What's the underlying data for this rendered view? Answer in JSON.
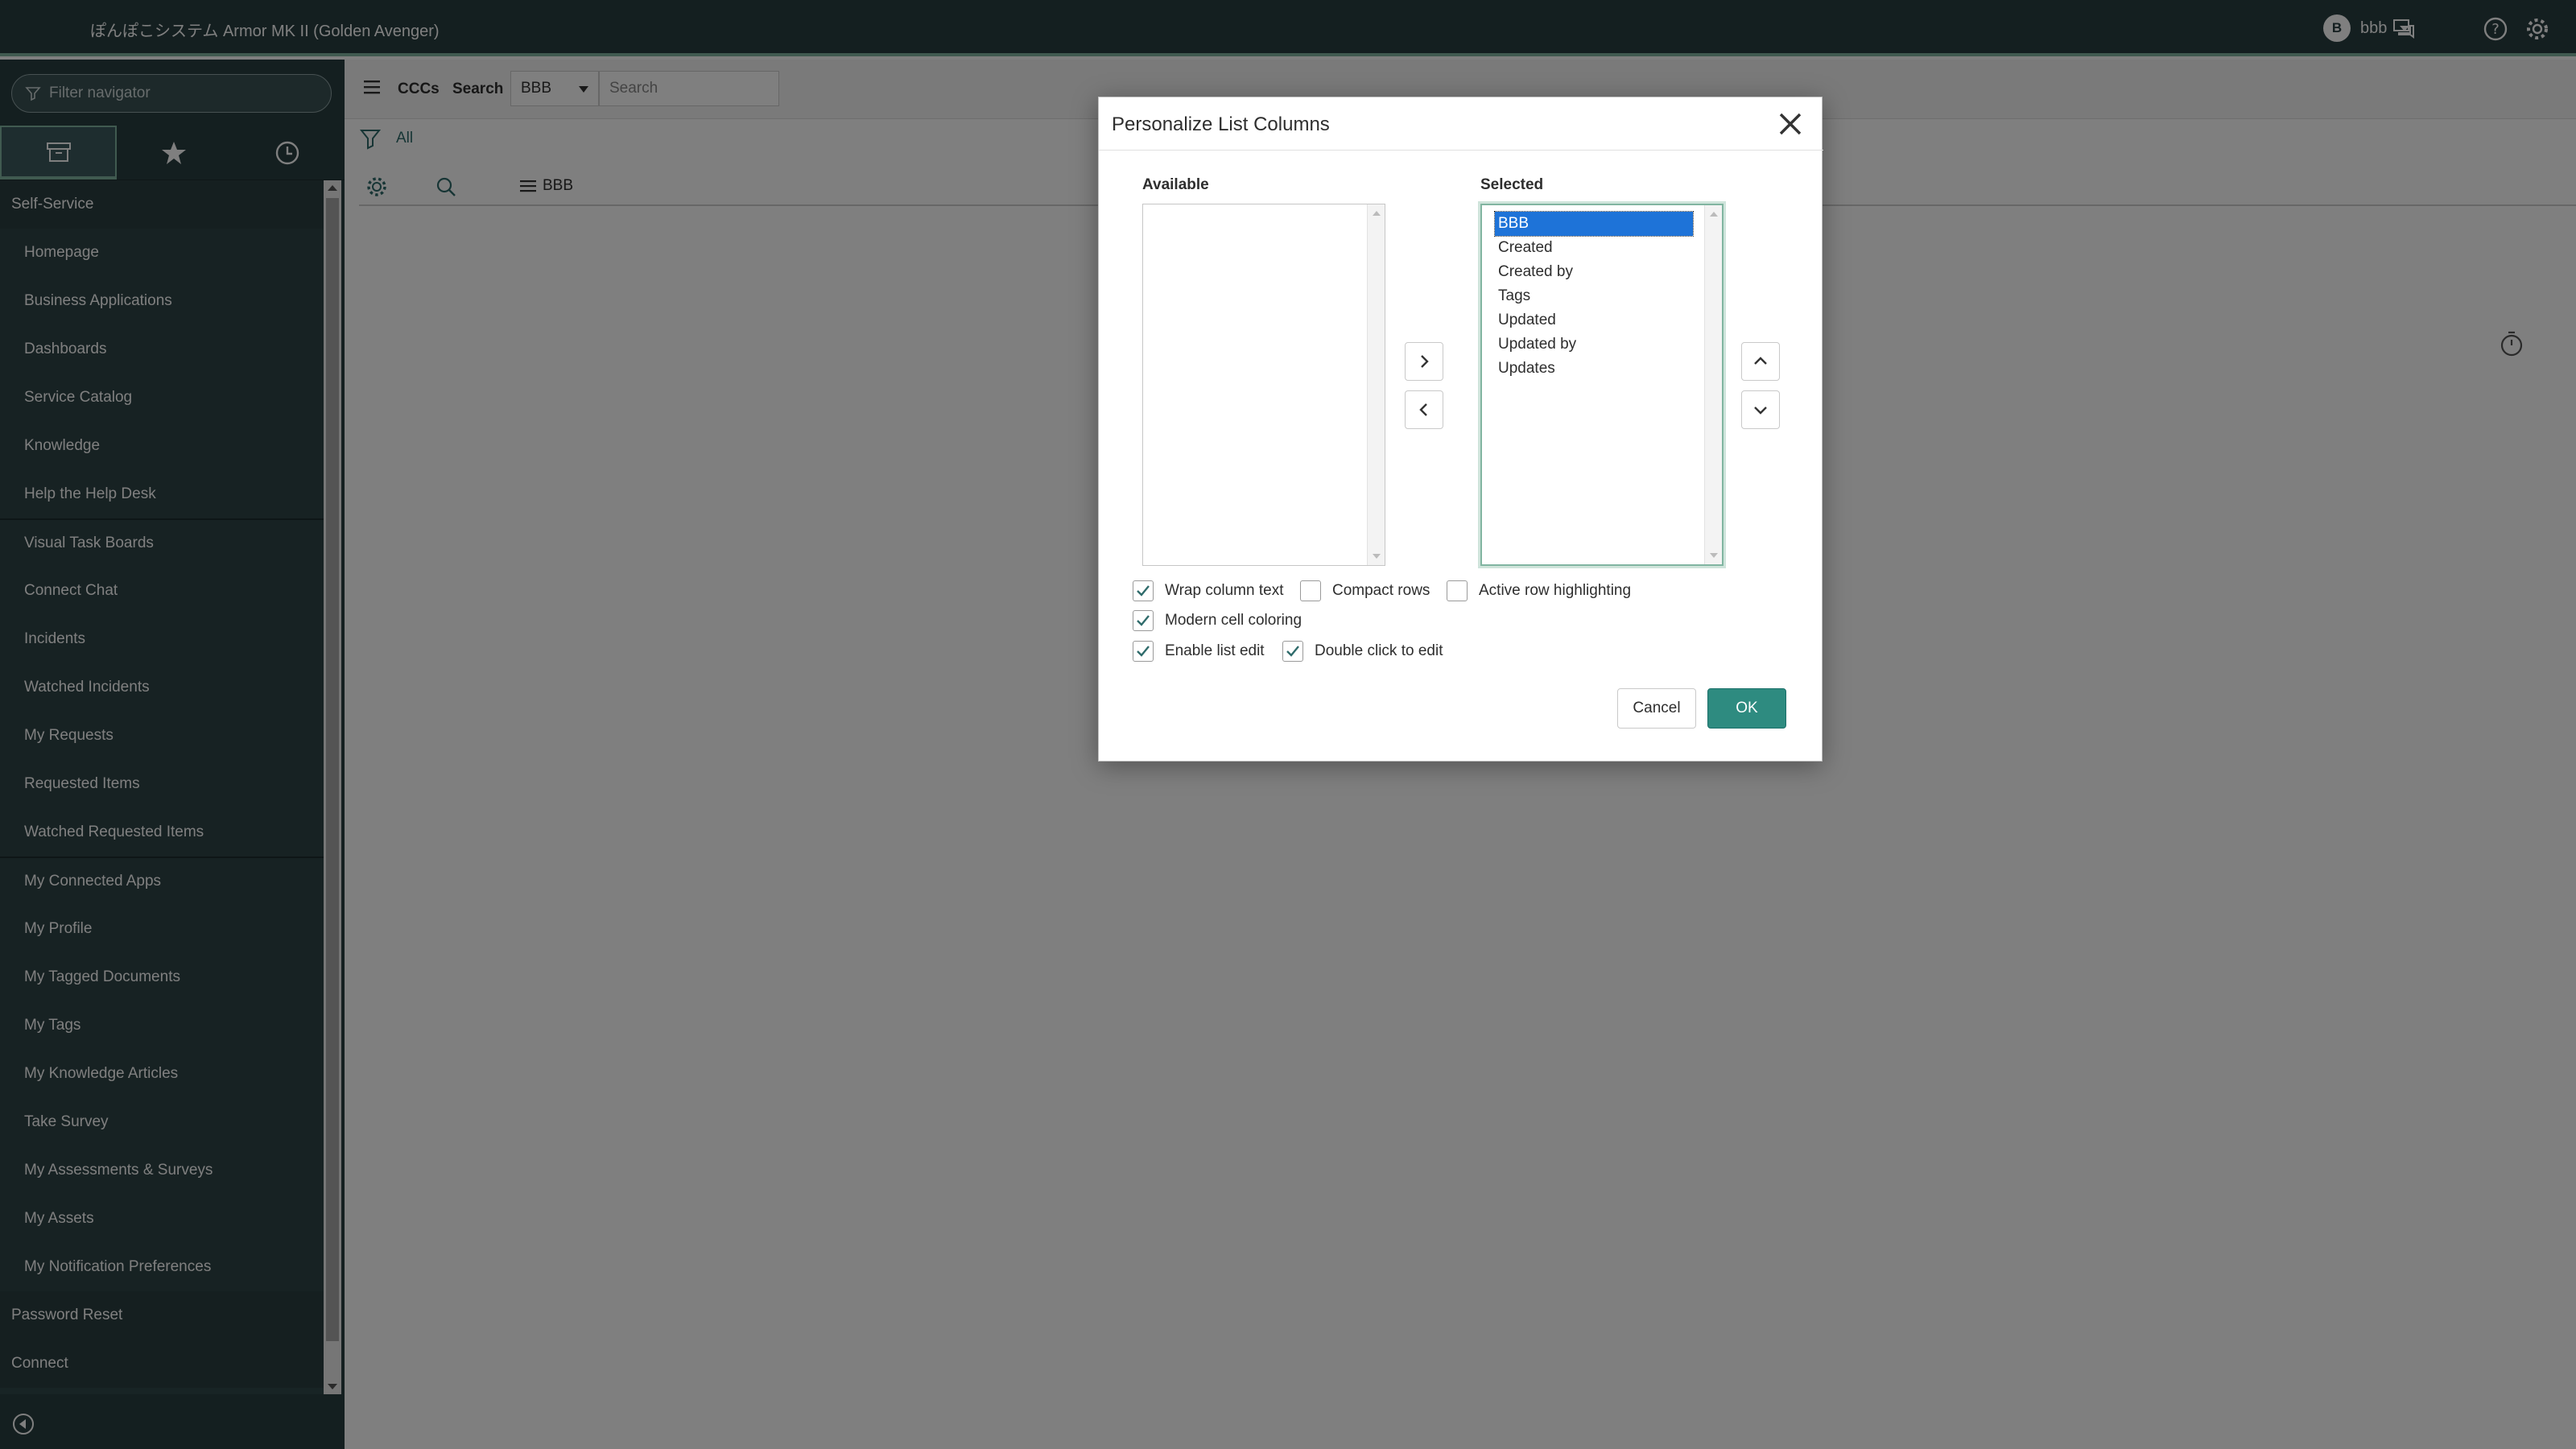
{
  "header": {
    "title": "ぽんぽこシステム Armor MK II (Golden Avenger)",
    "user_initial": "B",
    "user_name": "bbb"
  },
  "navigator": {
    "filter_placeholder": "Filter navigator",
    "items": [
      {
        "label": "Self-Service",
        "type": "section"
      },
      {
        "label": "Homepage"
      },
      {
        "label": "Business Applications"
      },
      {
        "label": "Dashboards"
      },
      {
        "label": "Service Catalog"
      },
      {
        "label": "Knowledge"
      },
      {
        "label": "Help the Help Desk"
      },
      {
        "label": "Visual Task Boards"
      },
      {
        "label": "Connect Chat"
      },
      {
        "label": "Incidents"
      },
      {
        "label": "Watched Incidents"
      },
      {
        "label": "My Requests"
      },
      {
        "label": "Requested Items"
      },
      {
        "label": "Watched Requested Items"
      },
      {
        "label": "My Connected Apps"
      },
      {
        "label": "My Profile"
      },
      {
        "label": "My Tagged Documents"
      },
      {
        "label": "My Tags"
      },
      {
        "label": "My Knowledge Articles"
      },
      {
        "label": "Take Survey"
      },
      {
        "label": "My Assessments & Surveys"
      },
      {
        "label": "My Assets"
      },
      {
        "label": "My Notification Preferences"
      },
      {
        "label": "Password Reset",
        "type": "section"
      },
      {
        "label": "Connect",
        "type": "section"
      }
    ]
  },
  "list": {
    "breadcrumb": "CCCs",
    "search_label": "Search",
    "field_select": "BBB",
    "search_placeholder": "Search",
    "filter_all": "All",
    "column_bbb": "BBB"
  },
  "dialog": {
    "title": "Personalize List Columns",
    "available_label": "Available",
    "selected_label": "Selected",
    "available_options": [],
    "selected_options": [
      "BBB",
      "Created",
      "Created by",
      "Tags",
      "Updated",
      "Updated by",
      "Updates"
    ],
    "selected_active": "BBB",
    "checkboxes": {
      "wrap": {
        "label": "Wrap column text",
        "checked": true
      },
      "compact": {
        "label": "Compact rows",
        "checked": false
      },
      "highlight": {
        "label": "Active row highlighting",
        "checked": false
      },
      "modern": {
        "label": "Modern cell coloring",
        "checked": true
      },
      "listedit": {
        "label": "Enable list edit",
        "checked": true
      },
      "dblclick": {
        "label": "Double click to edit",
        "checked": true
      }
    },
    "cancel_label": "Cancel",
    "ok_label": "OK"
  },
  "colors": {
    "header_bg": "#293e40",
    "accent": "#81b5a1",
    "ok_button": "#2e8b80",
    "selection": "#1e73d8"
  }
}
